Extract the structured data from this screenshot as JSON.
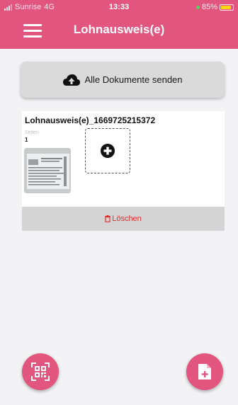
{
  "status": {
    "carrier": "Sunrise",
    "network": "4G",
    "time": "13:33",
    "battery_pct": "85%",
    "battery_level": 0.85,
    "signal_icon": "signal-icon",
    "battery_icon": "battery-icon"
  },
  "header": {
    "title": "Lohnausweis(e)",
    "menu_icon": "hamburger-menu-icon",
    "color": "#e2557f"
  },
  "actions": {
    "send_all_label": "Alle Dokumente senden",
    "send_icon": "cloud-upload-icon"
  },
  "document": {
    "name": "Lohnausweis(e)_1669725215372",
    "pages_label": "Seiten",
    "pages_count": "1",
    "add_icon": "plus-circle-icon",
    "delete_label": "Löschen",
    "delete_icon": "trash-icon",
    "delete_color": "#e03030"
  },
  "fabs": {
    "qr_icon": "qr-scan-icon",
    "add_doc_icon": "add-document-icon"
  }
}
